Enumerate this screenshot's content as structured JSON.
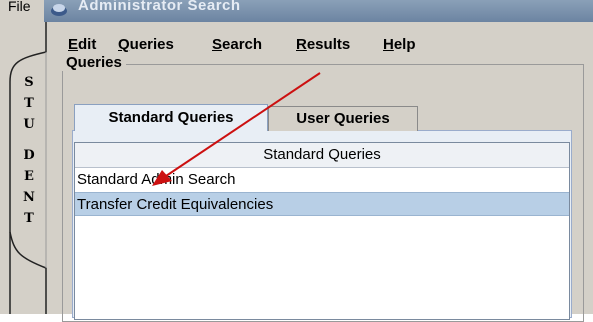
{
  "outer": {
    "file_label": "File"
  },
  "window": {
    "title": "Administrator Search"
  },
  "side_tab": {
    "letters": [
      "S",
      "T",
      "U",
      "D",
      "E",
      "N",
      "T"
    ]
  },
  "menu": [
    {
      "label": "Edit",
      "key": "E",
      "rest": "dit"
    },
    {
      "label": "Queries",
      "key": "Q",
      "rest": "ueries"
    },
    {
      "label": "Search",
      "key": "S",
      "rest": "earch"
    },
    {
      "label": "Results",
      "key": "R",
      "rest": "esults"
    },
    {
      "label": "Help",
      "key": "H",
      "rest": "elp"
    }
  ],
  "group": {
    "title": "Queries"
  },
  "tabs": [
    {
      "label": "Standard Queries",
      "active": true
    },
    {
      "label": "User Queries",
      "active": false
    }
  ],
  "list": {
    "header": "Standard Queries",
    "rows": [
      {
        "label": "Standard Admin Search",
        "selected": false
      },
      {
        "label": "Transfer Credit Equivalencies",
        "selected": true
      }
    ]
  },
  "colors": {
    "annotation_arrow": "#cc1010",
    "selection": "#b8cfe6",
    "title_bar": "#7c92ae"
  }
}
